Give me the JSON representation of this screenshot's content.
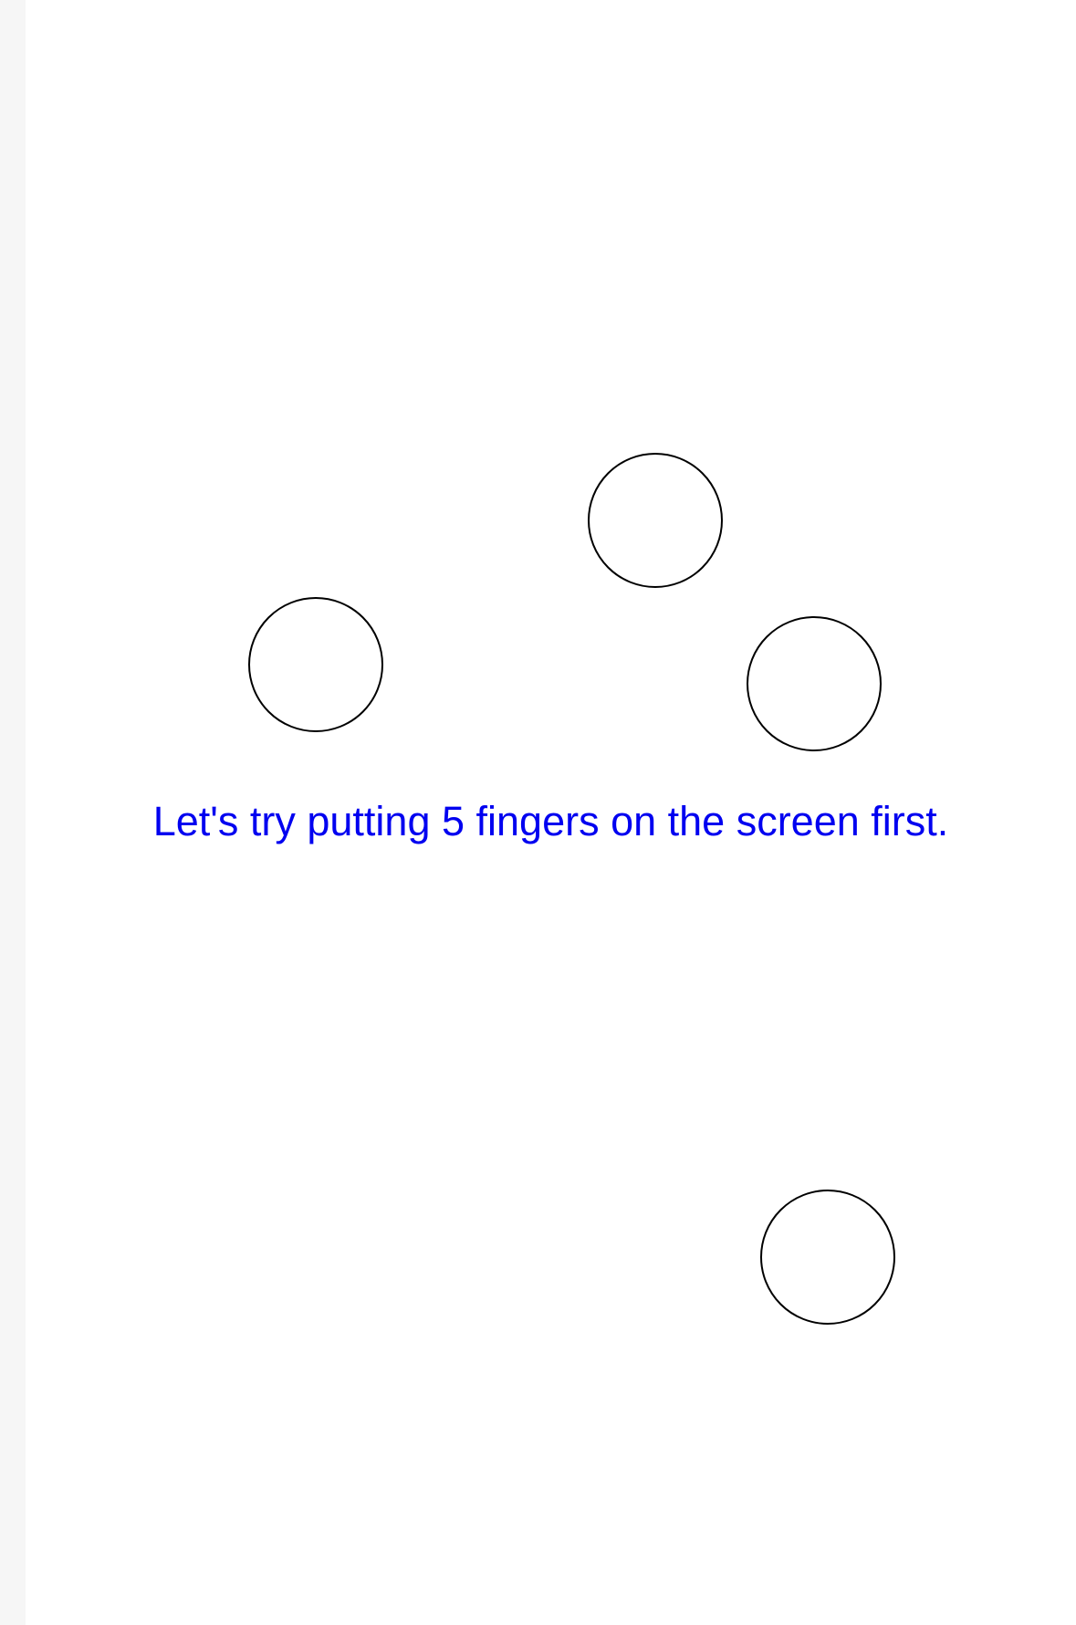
{
  "instruction": {
    "text": "Let's try putting 5 fingers on the screen first.",
    "color": "#0000f0"
  },
  "touch_circles": {
    "count_visible": 4,
    "stroke_color": "#000000"
  },
  "colors": {
    "background": "#ffffff",
    "edge_strip": "#f6f6f6"
  }
}
